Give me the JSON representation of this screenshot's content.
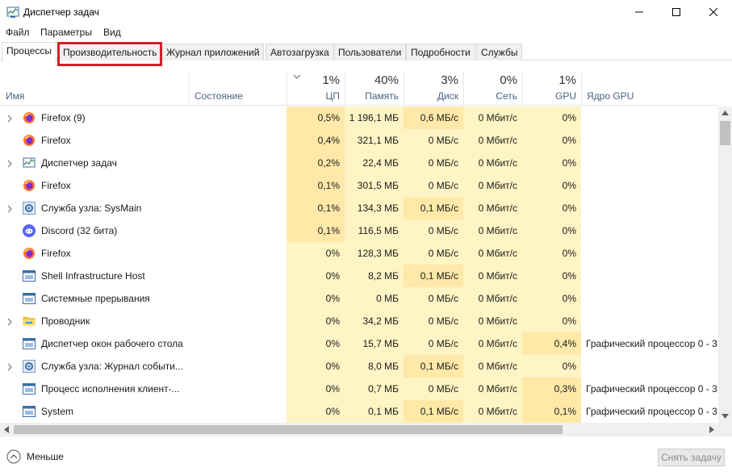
{
  "window": {
    "title": "Диспетчер задач"
  },
  "menu": {
    "file": "Файл",
    "options": "Параметры",
    "view": "Вид"
  },
  "tabs": [
    {
      "label": "Процессы"
    },
    {
      "label": "Производительность"
    },
    {
      "label": "Журнал приложений"
    },
    {
      "label": "Автозагрузка"
    },
    {
      "label": "Пользователи"
    },
    {
      "label": "Подробности"
    },
    {
      "label": "Службы"
    }
  ],
  "columns": {
    "name": "Имя",
    "state": "Состояние",
    "cpu": {
      "pct": "1%",
      "label": "ЦП"
    },
    "mem": {
      "pct": "40%",
      "label": "Память"
    },
    "disk": {
      "pct": "3%",
      "label": "Диск"
    },
    "net": {
      "pct": "0%",
      "label": "Сеть"
    },
    "gpu": {
      "pct": "1%",
      "label": "GPU"
    },
    "gpu_engine": "Ядро GPU"
  },
  "rows": [
    {
      "name": "Firefox (9)",
      "icon": "firefox-icon",
      "expandable": true,
      "cpu": "0,5%",
      "mem": "1 196,1 МБ",
      "disk": "0,6 МБ/с",
      "net": "0 Мбит/с",
      "gpu": "0%",
      "engine": ""
    },
    {
      "name": "Firefox",
      "icon": "firefox-icon",
      "expandable": false,
      "cpu": "0,4%",
      "mem": "321,1 МБ",
      "disk": "0 МБ/с",
      "net": "0 Мбит/с",
      "gpu": "0%",
      "engine": ""
    },
    {
      "name": "Диспетчер задач",
      "icon": "task-manager-icon",
      "expandable": true,
      "cpu": "0,2%",
      "mem": "22,4 МБ",
      "disk": "0 МБ/с",
      "net": "0 Мбит/с",
      "gpu": "0%",
      "engine": ""
    },
    {
      "name": "Firefox",
      "icon": "firefox-icon",
      "expandable": false,
      "cpu": "0,1%",
      "mem": "301,5 МБ",
      "disk": "0 МБ/с",
      "net": "0 Мбит/с",
      "gpu": "0%",
      "engine": ""
    },
    {
      "name": "Служба узла: SysMain",
      "icon": "gear-icon",
      "expandable": true,
      "cpu": "0,1%",
      "mem": "134,3 МБ",
      "disk": "0,1 МБ/с",
      "net": "0 Мбит/с",
      "gpu": "0%",
      "engine": ""
    },
    {
      "name": "Discord (32 бита)",
      "icon": "discord-icon",
      "expandable": false,
      "cpu": "0,1%",
      "mem": "116,5 МБ",
      "disk": "0 МБ/с",
      "net": "0 Мбит/с",
      "gpu": "0%",
      "engine": ""
    },
    {
      "name": "Firefox",
      "icon": "firefox-icon",
      "expandable": false,
      "cpu": "0%",
      "mem": "128,3 МБ",
      "disk": "0 МБ/с",
      "net": "0 Мбит/с",
      "gpu": "0%",
      "engine": ""
    },
    {
      "name": "Shell Infrastructure Host",
      "icon": "window-icon",
      "expandable": false,
      "cpu": "0%",
      "mem": "8,2 МБ",
      "disk": "0,1 МБ/с",
      "net": "0 Мбит/с",
      "gpu": "0%",
      "engine": ""
    },
    {
      "name": "Системные прерывания",
      "icon": "window-icon",
      "expandable": false,
      "cpu": "0%",
      "mem": "0 МБ",
      "disk": "0 МБ/с",
      "net": "0 Мбит/с",
      "gpu": "0%",
      "engine": ""
    },
    {
      "name": "Проводник",
      "icon": "folder-icon",
      "expandable": true,
      "cpu": "0%",
      "mem": "34,2 МБ",
      "disk": "0 МБ/с",
      "net": "0 Мбит/с",
      "gpu": "0%",
      "engine": ""
    },
    {
      "name": "Диспетчер окон рабочего стола",
      "icon": "window-icon",
      "expandable": false,
      "cpu": "0%",
      "mem": "15,7 МБ",
      "disk": "0 МБ/с",
      "net": "0 Мбит/с",
      "gpu": "0,4%",
      "engine": "Графический процессор 0 - 3"
    },
    {
      "name": "Служба узла: Журнал событи...",
      "icon": "gear-icon",
      "expandable": true,
      "cpu": "0%",
      "mem": "8,0 МБ",
      "disk": "0,1 МБ/с",
      "net": "0 Мбит/с",
      "gpu": "0%",
      "engine": ""
    },
    {
      "name": "Процесс исполнения клиент-...",
      "icon": "window-icon",
      "expandable": false,
      "cpu": "0%",
      "mem": "0,7 МБ",
      "disk": "0 МБ/с",
      "net": "0 Мбит/с",
      "gpu": "0,3%",
      "engine": "Графический процессор 0 - 3"
    },
    {
      "name": "System",
      "icon": "window-icon",
      "expandable": false,
      "cpu": "0%",
      "mem": "0,1 МБ",
      "disk": "0,1 МБ/с",
      "net": "0 Мбит/с",
      "gpu": "0,1%",
      "engine": "Графический процессор 0 - 3"
    }
  ],
  "footer": {
    "less": "Меньше",
    "end_task": "Снять задачу"
  },
  "colors": {
    "heat_light": "#fff4c4",
    "heat_mid": "#ffe9a8",
    "highlight": "#d0202a"
  }
}
